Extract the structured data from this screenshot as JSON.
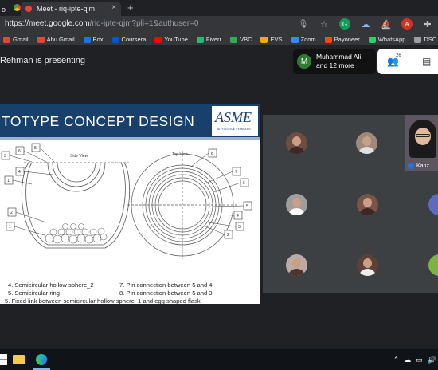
{
  "browser": {
    "tab_left_label": "o",
    "tab_title": "Meet - riq-ipte-qjm",
    "tab_close": "×",
    "new_tab": "+",
    "url_host": "https://meet.google.com",
    "url_path": "/riq-ipte-qjm?pli=1&authuser=0",
    "bookmarks": [
      {
        "label": "Gmail",
        "color": "#ea4335"
      },
      {
        "label": "Abu Gmail",
        "color": "#ea4335"
      },
      {
        "label": "Box",
        "color": "#1a73e8"
      },
      {
        "label": "Coursera",
        "color": "#0056d2"
      },
      {
        "label": "YouTube",
        "color": "#ff0000"
      },
      {
        "label": "Fiverr",
        "color": "#1dbf73"
      },
      {
        "label": "VBC",
        "color": "#34a853"
      },
      {
        "label": "EVS",
        "color": "#f9ab00"
      },
      {
        "label": "Zoom",
        "color": "#2d8cff"
      },
      {
        "label": "Payoneer",
        "color": "#ff4800"
      },
      {
        "label": "WhatsApp",
        "color": "#25d366"
      },
      {
        "label": "DSC",
        "color": "#9aa0a6"
      }
    ]
  },
  "meet": {
    "presenting_text": "Rehman is presenting",
    "participant_initial": "M",
    "participant_name": "Muhammad Ali",
    "participant_more": "and 12 more",
    "people_count": "26",
    "cam_name": "Kanz"
  },
  "slide": {
    "title": "TOTYPE CONCEPT DESIGN",
    "logo_text": "ASME",
    "logo_sub": "SETTING THE STANDARD",
    "side_view_label": "Side View",
    "top_view_label": "Top View",
    "side_numbers": [
      "3",
      "6",
      "5",
      "4",
      "1",
      "2",
      "1"
    ],
    "top_numbers": [
      "8",
      "7",
      "6",
      "5",
      "4",
      "3",
      "2"
    ],
    "captions": [
      {
        "a": "4.  Semicircular hollow sphere_2",
        "b": "7.  Pin connection between 5 and 4"
      },
      {
        "a": "5.  Semicircular ring",
        "b": "8.  Pin connection between 5 and 3"
      }
    ],
    "caption_partial": "5. Fixed link between semicircular hollow sphere_1 and egg shaped flask"
  },
  "colors": {
    "slide_header": "#17406d",
    "meet_bg": "#202124",
    "grid_bg": "#3c4043"
  }
}
